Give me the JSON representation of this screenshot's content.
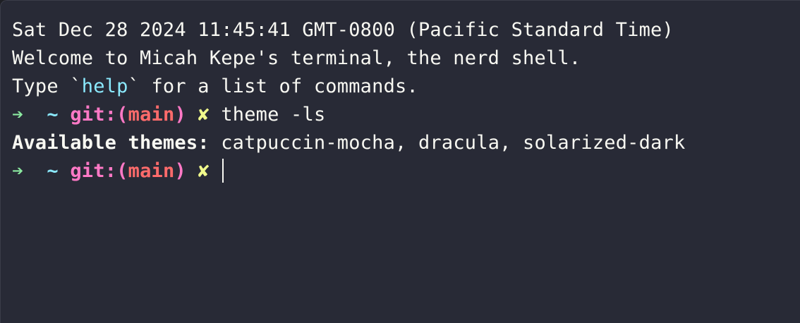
{
  "colors": {
    "background": "#282a36",
    "foreground": "#f8f8f2",
    "prompt_arrow": "#8be9a0",
    "prompt_dir": "#8be9fd",
    "prompt_git": "#ff79c6",
    "prompt_branch": "#ff6b6b",
    "prompt_dirty": "#f1fa8c",
    "help_highlight": "#8be9fd"
  },
  "output": {
    "date_line": "Sat Dec 28 2024 11:45:41 GMT-0800 (Pacific Standard Time)",
    "welcome_line": "Welcome to Micah Kepe's terminal, the nerd shell.",
    "type_prefix": "Type `",
    "help_word": "help",
    "type_suffix": "` for a list of commands."
  },
  "prompt": {
    "arrow": "➔",
    "dir": "~",
    "git_label": "git:(",
    "branch": "main",
    "git_close": ")",
    "dirty_mark": "✘"
  },
  "history": {
    "command": "theme -ls",
    "themes_label": "Available themes:",
    "themes_list": "catpuccin-mocha, dracula, solarized-dark"
  },
  "input": {
    "current_value": ""
  }
}
